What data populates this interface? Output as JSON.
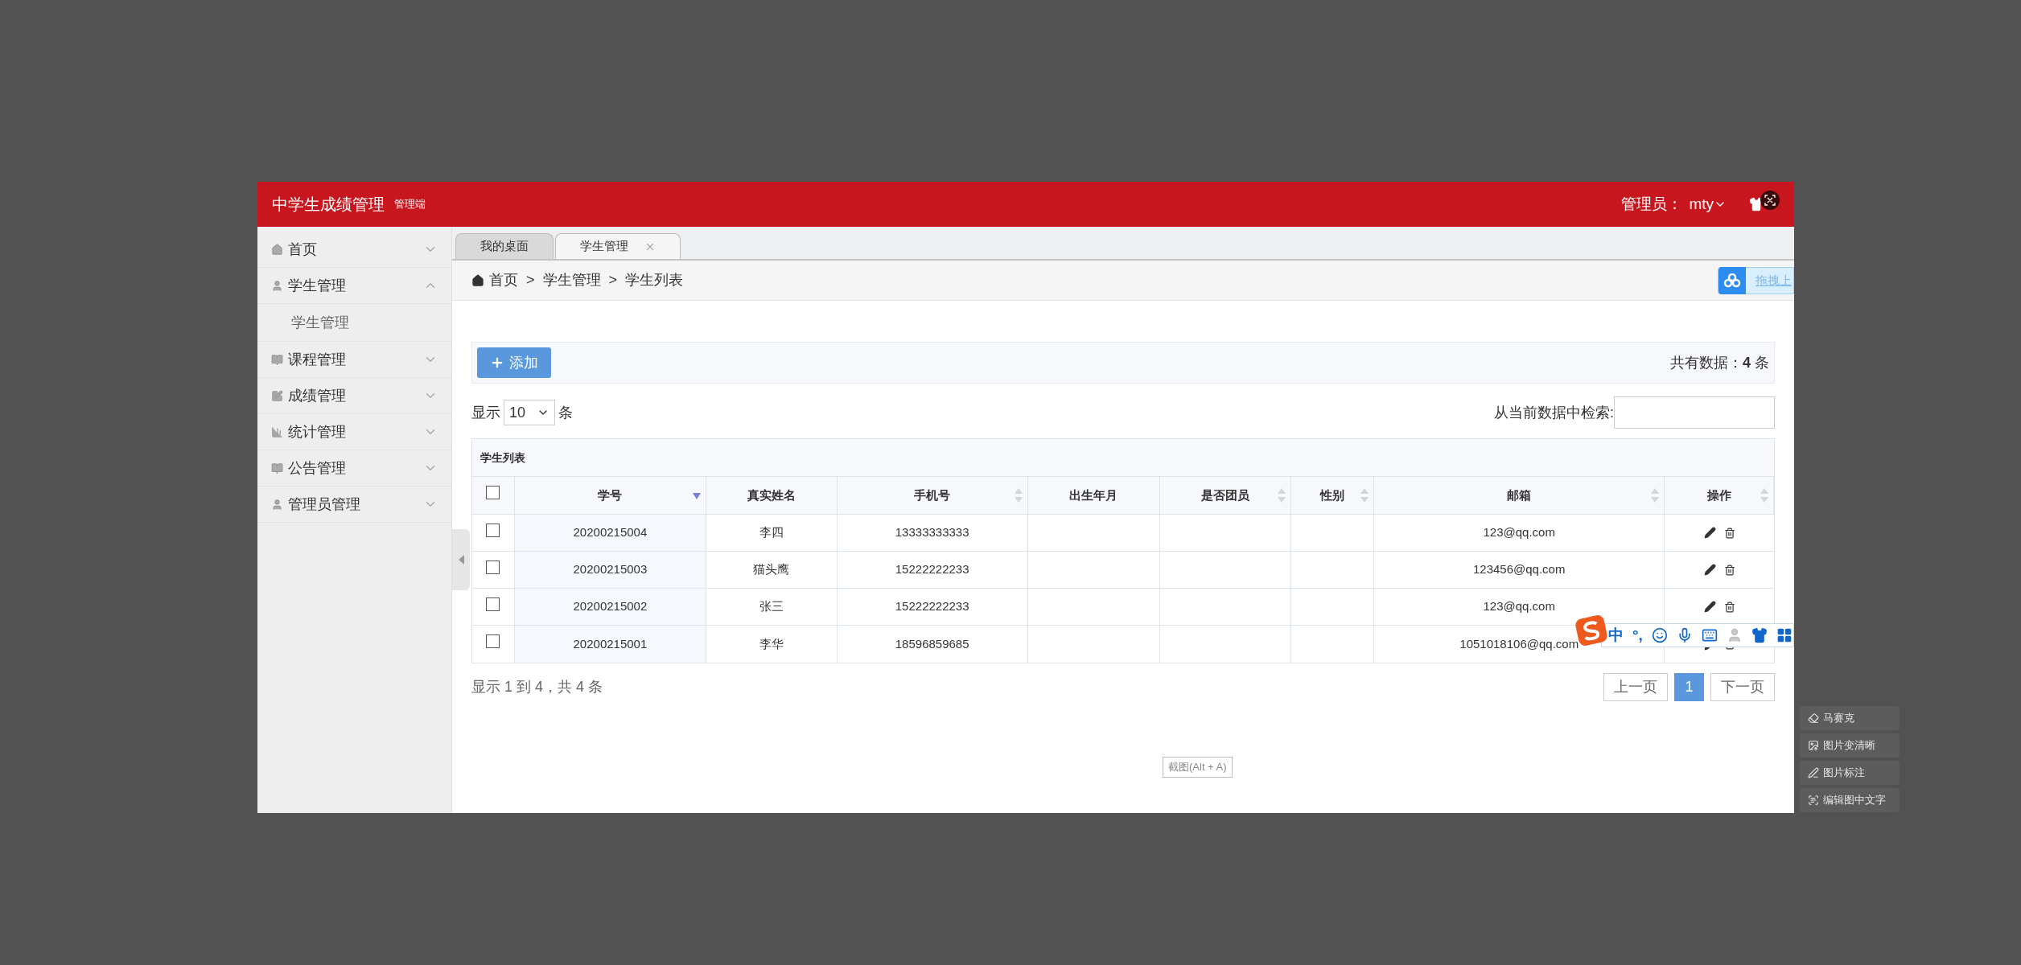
{
  "header": {
    "title": "中学生成绩管理",
    "subtitle": "管理端",
    "admin_label": "管理员：",
    "username": "mty"
  },
  "sidebar": {
    "items": [
      {
        "label": "首页",
        "expanded": false
      },
      {
        "label": "学生管理",
        "expanded": true,
        "children": [
          {
            "label": "学生管理"
          }
        ]
      },
      {
        "label": "课程管理",
        "expanded": false
      },
      {
        "label": "成绩管理",
        "expanded": false
      },
      {
        "label": "统计管理",
        "expanded": false
      },
      {
        "label": "公告管理",
        "expanded": false
      },
      {
        "label": "管理员管理",
        "expanded": false
      }
    ]
  },
  "tabs": [
    {
      "label": "我的桌面",
      "selected": false,
      "closable": false
    },
    {
      "label": "学生管理",
      "selected": true,
      "closable": true
    }
  ],
  "breadcrumb": {
    "items": [
      "首页",
      "学生管理",
      "学生列表"
    ],
    "separators": [
      ">",
      ">"
    ]
  },
  "upload_widget": {
    "label": "拖拽上"
  },
  "toolbar": {
    "add_button": "添加",
    "total": "共有数据：**4** 条"
  },
  "length_control": {
    "prefix": "显示",
    "value": "10",
    "suffix": "条"
  },
  "search": {
    "label": "从当前数据中检索:"
  },
  "table": {
    "caption": "学生列表",
    "select_all_checked": false,
    "columns": [
      {
        "label": "学号",
        "sortable": true,
        "sorted": true
      },
      {
        "label": "真实姓名",
        "sortable": false
      },
      {
        "label": "手机号",
        "sortable": true,
        "sorted": false
      },
      {
        "label": "出生年月",
        "sortable": false
      },
      {
        "label": "是否团员",
        "sortable": true,
        "sorted": false
      },
      {
        "label": "性别",
        "sortable": true,
        "sorted": false
      },
      {
        "label": "邮箱",
        "sortable": true,
        "sorted": false
      },
      {
        "label": "操作",
        "sortable": true,
        "sorted": false
      }
    ],
    "rows": [
      {
        "checked": false,
        "cells": [
          "20200215004",
          "李四",
          "13333333333",
          "",
          "",
          "",
          "123@qq.com"
        ]
      },
      {
        "checked": false,
        "cells": [
          "20200215003",
          "猫头鹰",
          "15222222233",
          "",
          "",
          "",
          "123456@qq.com"
        ]
      },
      {
        "checked": false,
        "cells": [
          "20200215002",
          "张三",
          "15222222233",
          "",
          "",
          "",
          "123@qq.com"
        ]
      },
      {
        "checked": false,
        "cells": [
          "20200215001",
          "李华",
          "18596859685",
          "",
          "",
          "",
          "1051018106@qq.com"
        ]
      }
    ]
  },
  "pagination": {
    "info": "显示 1 到 4，共 4 条",
    "prev": "上一页",
    "pages": [
      {
        "label": "1",
        "selected": true
      }
    ],
    "next": "下一页"
  },
  "ime_bar": {
    "mode": "中",
    "punctuation": "°,"
  },
  "screenshot_hint": "截图(Alt + A)",
  "screenshot_tools": [
    "马赛克",
    "图片变清晰",
    "图片标注",
    "编辑图中文字"
  ]
}
